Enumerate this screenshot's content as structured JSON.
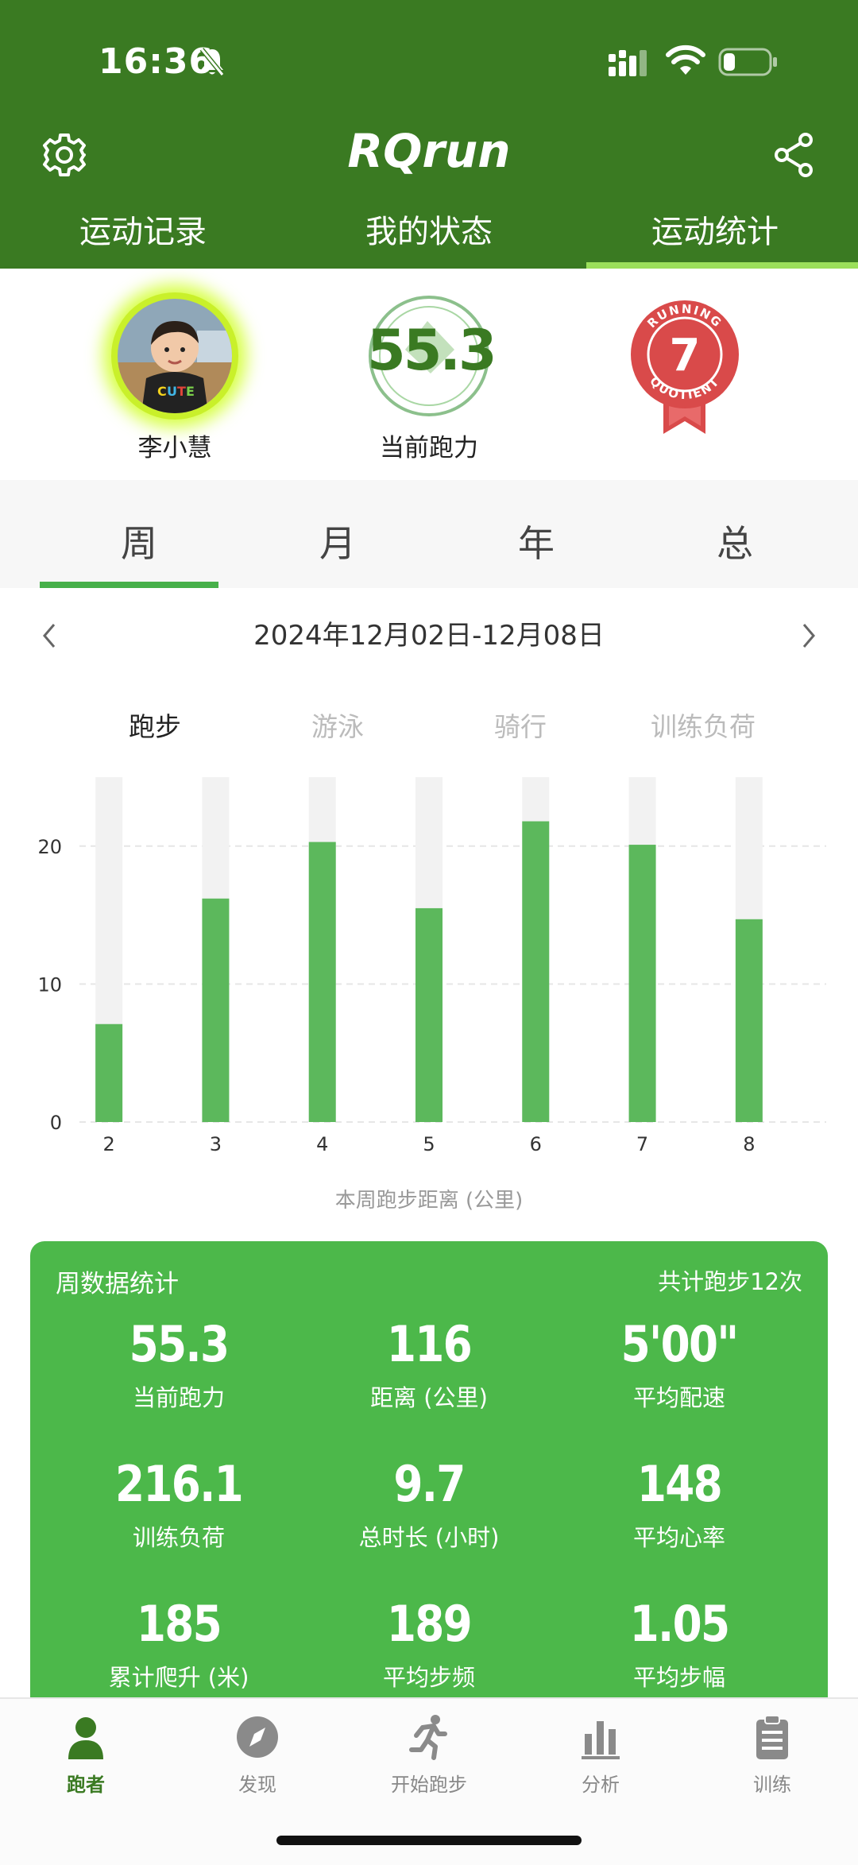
{
  "status_bar": {
    "time": "16:36"
  },
  "app": {
    "title": "RQrun"
  },
  "main_tabs": [
    {
      "label": "运动记录"
    },
    {
      "label": "我的状态"
    },
    {
      "label": "运动统计",
      "active": true
    }
  ],
  "profile": {
    "name": "李小慧",
    "vo2_value": "55.3",
    "vo2_label": "当前跑力",
    "rq_badge": {
      "top_text": "RUNNING",
      "bottom_text": "QUOTIENT",
      "value": "7"
    }
  },
  "period_tabs": [
    {
      "label": "周",
      "active": true
    },
    {
      "label": "月"
    },
    {
      "label": "年"
    },
    {
      "label": "总"
    }
  ],
  "date_range": "2024年12月02日-12月08日",
  "sport_tabs": [
    {
      "label": "跑步",
      "active": true
    },
    {
      "label": "游泳"
    },
    {
      "label": "骑行"
    },
    {
      "label": "训练负荷"
    }
  ],
  "chart_data": {
    "type": "bar",
    "categories": [
      "2",
      "3",
      "4",
      "5",
      "6",
      "7",
      "8"
    ],
    "values": [
      7.1,
      16.2,
      20.3,
      15.5,
      21.8,
      20.1,
      14.7
    ],
    "ylim": [
      0,
      25
    ],
    "yticks": [
      "0",
      "10",
      "20"
    ],
    "ytick_values": [
      0,
      10,
      20
    ],
    "xlabel": "本周跑步距离 (公里)",
    "bar_color": "#5cb85c",
    "track_color": "#f2f2f2",
    "grid": true
  },
  "stats": {
    "title": "周数据统计",
    "count": "共计跑步12次",
    "items": [
      {
        "value": "55.3",
        "label": "当前跑力"
      },
      {
        "value": "116",
        "label": "距离 (公里)"
      },
      {
        "value": "5'00\"",
        "label": "平均配速"
      },
      {
        "value": "216.1",
        "label": "训练负荷"
      },
      {
        "value": "9.7",
        "label": "总时长 (小时)"
      },
      {
        "value": "148",
        "label": "平均心率"
      },
      {
        "value": "185",
        "label": "累计爬升 (米)"
      },
      {
        "value": "189",
        "label": "平均步频"
      },
      {
        "value": "1.05",
        "label": "平均步幅"
      }
    ]
  },
  "bottom_nav": [
    {
      "label": "跑者",
      "icon": "runner-profile-icon",
      "active": true
    },
    {
      "label": "发现",
      "icon": "compass-icon"
    },
    {
      "label": "开始跑步",
      "icon": "running-man-icon"
    },
    {
      "label": "分析",
      "icon": "bar-chart-icon"
    },
    {
      "label": "训练",
      "icon": "clipboard-icon"
    }
  ],
  "colors": {
    "header": "#3a7a22",
    "accent": "#9be05b",
    "card": "#4cb84a",
    "bar": "#5cb85c"
  }
}
